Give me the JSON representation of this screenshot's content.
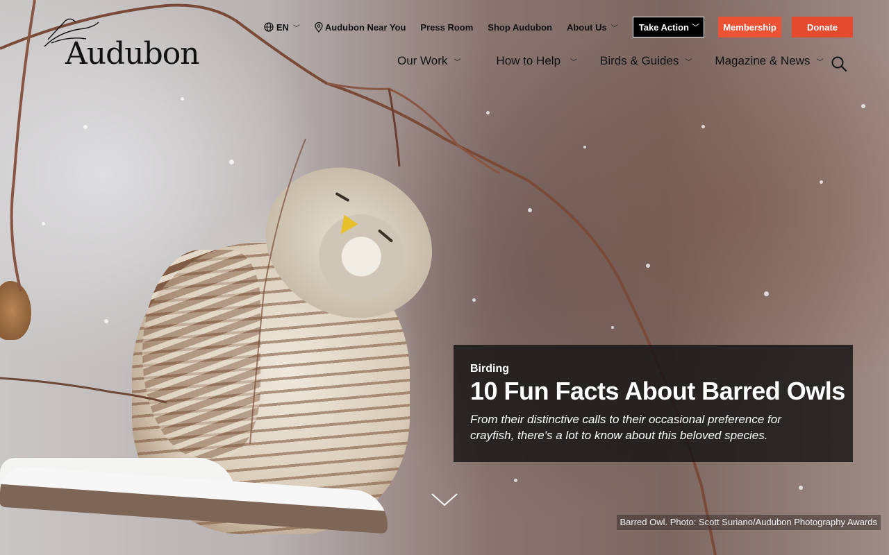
{
  "header": {
    "logo_text": "Audubon",
    "utility": {
      "language": "EN",
      "near_you": "Audubon Near You",
      "press_room": "Press Room",
      "shop": "Shop Audubon",
      "about": "About Us",
      "take_action": "Take Action",
      "membership": "Membership",
      "donate": "Donate"
    },
    "nav": {
      "our_work": "Our Work",
      "how_to_help": "How to Help",
      "birds_guides": "Birds & Guides",
      "magazine_news": "Magazine & News"
    }
  },
  "feature": {
    "kicker": "Birding",
    "title": "10 Fun Facts About Barred Owls",
    "description": "From their distinctive calls to their occasional preference for crayfish, there's a lot to know about this beloved species."
  },
  "photo_credit": "Barred Owl. Photo: Scott Suriano/Audubon Photography Awards",
  "colors": {
    "membership": "#ee5235",
    "donate": "#e64a2e",
    "take_action": "#000000",
    "card_bg": "#141414"
  },
  "icons": {
    "language": "globe-icon",
    "location": "map-pin-icon",
    "search": "search-icon",
    "scroll": "chevron-down-icon"
  }
}
